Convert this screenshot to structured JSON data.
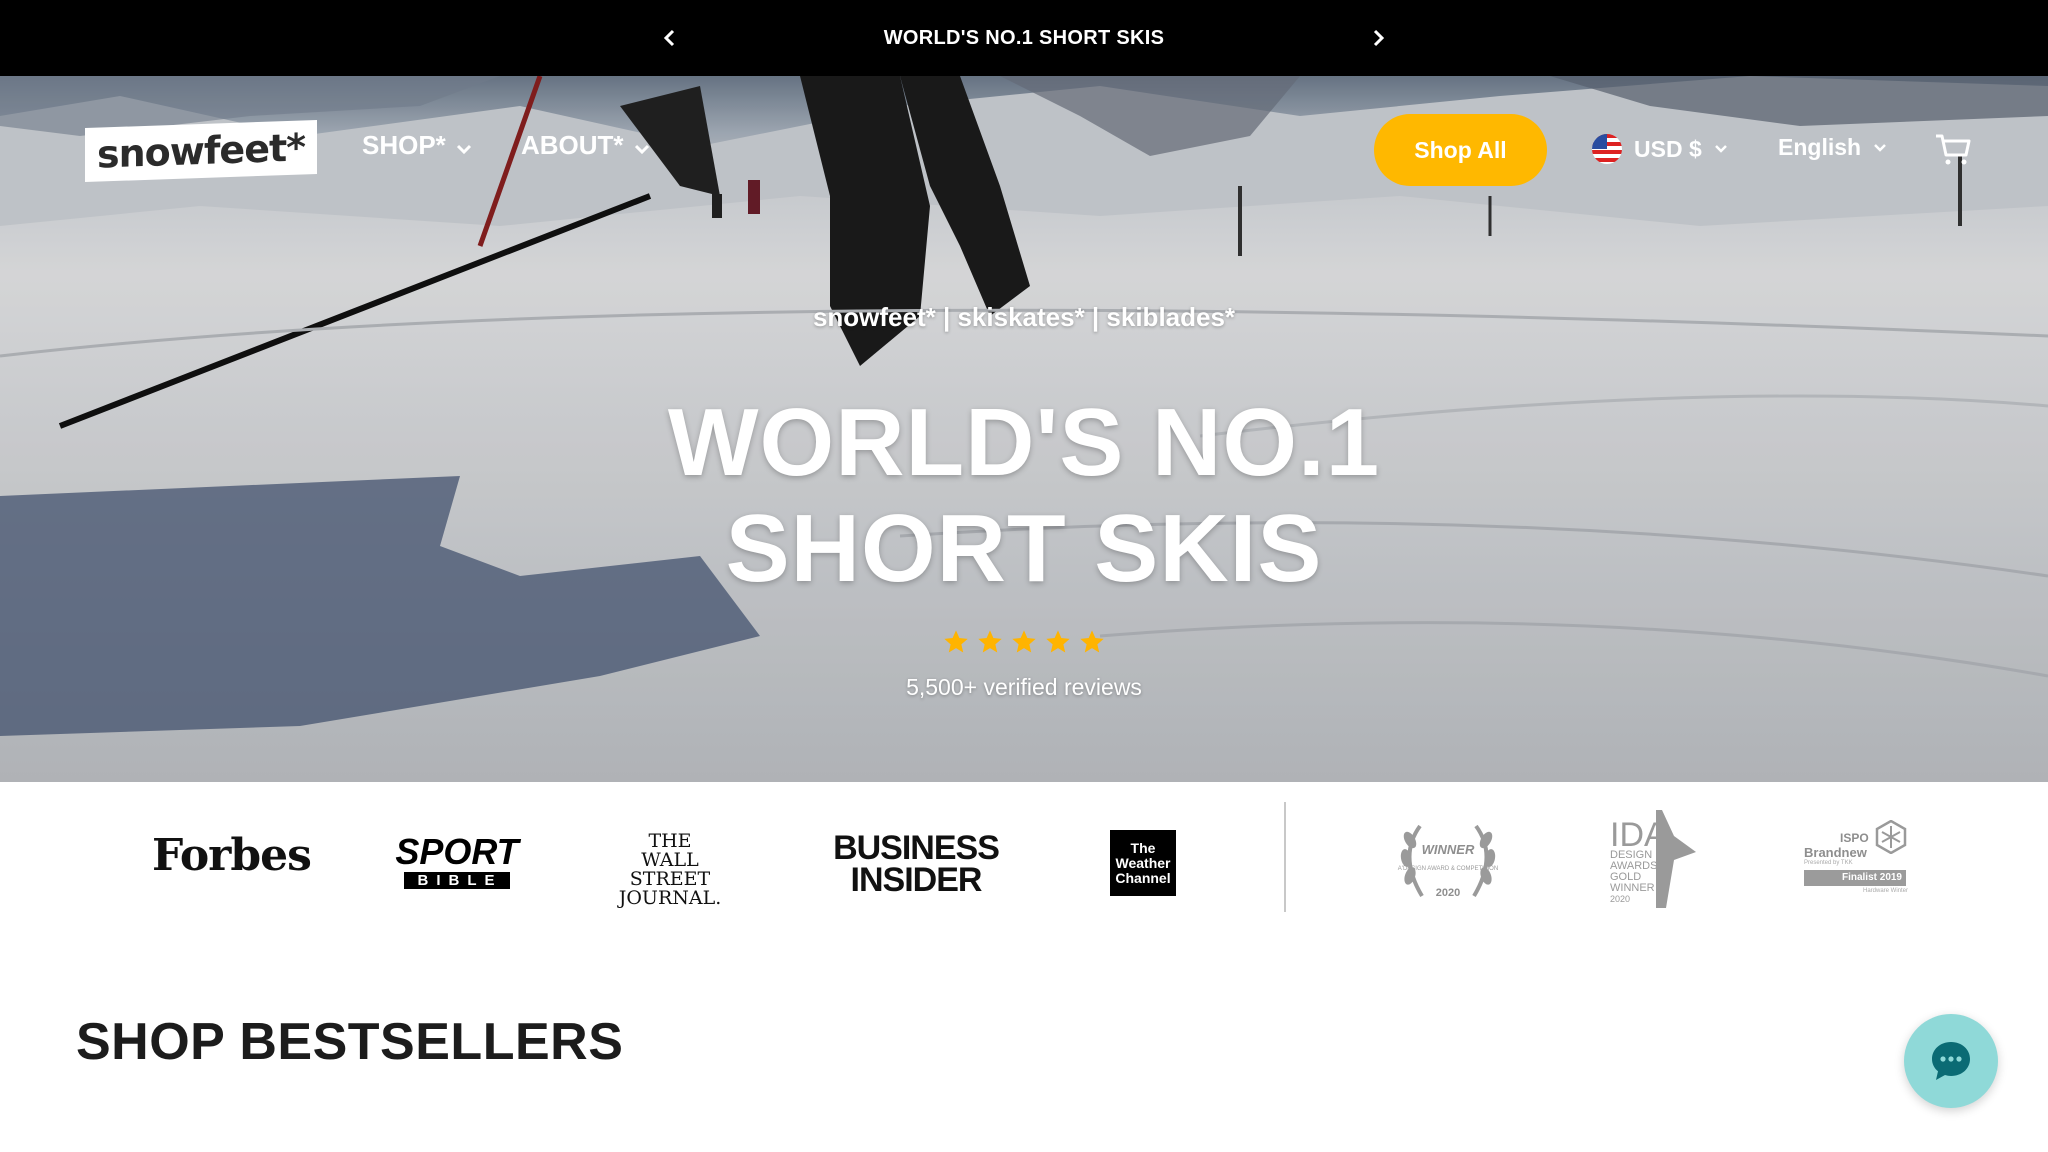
{
  "announcement": {
    "text": "WORLD'S NO.1 SHORT SKIS"
  },
  "header": {
    "logo_text": "snowfeet*",
    "nav": [
      {
        "label": "SHOP*"
      },
      {
        "label": "ABOUT*"
      }
    ],
    "shop_all_label": "Shop All",
    "currency_label": "USD $",
    "language_label": "English"
  },
  "hero": {
    "subtitle": "snowfeet* | skiskates* | skiblades*",
    "title_line1": "WORLD'S NO.1",
    "title_line2": "SHORT SKIS",
    "rating_stars": 5,
    "reviews_text": "5,500+ verified reviews"
  },
  "press": {
    "forbes": "Forbes",
    "sportbible_top": "SPORT",
    "sportbible_bottom": "BIBLE",
    "wsj_line1": "THE",
    "wsj_line2": "WALL STREET",
    "wsj_line3": "JOURNAL.",
    "bi_line1": "BUSINESS",
    "bi_line2": "INSIDER",
    "twc_line1": "The",
    "twc_line2": "Weather",
    "twc_line3": "Channel"
  },
  "awards": {
    "winner_label": "WINNER",
    "winner_sub": "A'DESIGN AWARD & COMPETITION",
    "winner_year": "2020",
    "ida_line1": "IDA",
    "ida_line2": "DESIGN",
    "ida_line3": "AWARDS",
    "ida_line4": "GOLD",
    "ida_line5": "WINNER",
    "ida_year": "2020",
    "ispo_line1": "ISPO",
    "ispo_line2": "Brandnew",
    "ispo_presented": "Presented by TKK",
    "ispo_finalist": "Finalist 2019",
    "ispo_category": "Hardware Winter"
  },
  "section": {
    "bestsellers_title": "SHOP BESTSELLERS"
  },
  "colors": {
    "accent": "#ffb800",
    "announcement_bg": "#000000",
    "chat_bg": "#8fd9d8",
    "star": "#ffb400"
  }
}
